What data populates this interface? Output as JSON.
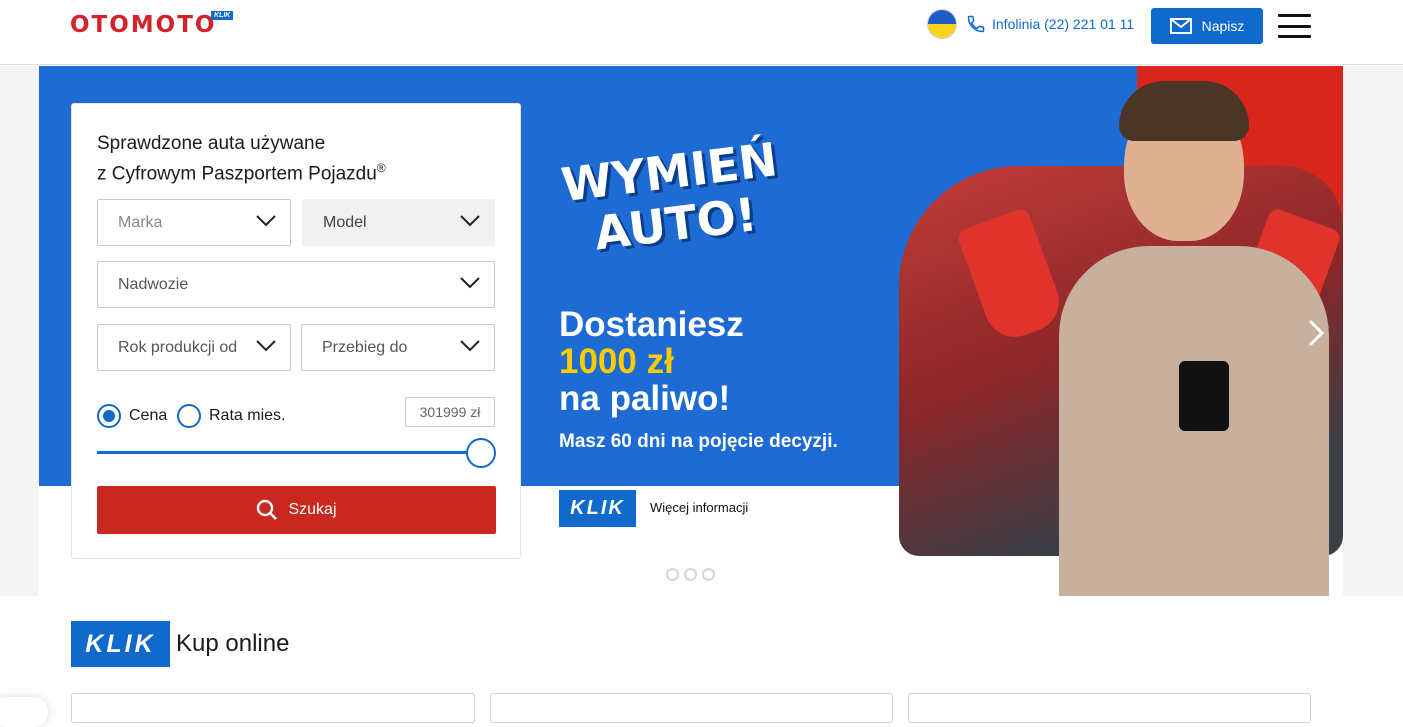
{
  "header": {
    "logo": "OTOMOTO",
    "logo_badge": "KLIK",
    "flag_icon": "ukraine-flag-icon",
    "infolinia": "Infolinia (22) 221 01 11",
    "napisz": "Napisz"
  },
  "search": {
    "title_line1": "Sprawdzone auta używane",
    "title_line2": "z Cyfrowym Paszportem Pojazdu",
    "title_mark": "®",
    "marka": "Marka",
    "model": "Model",
    "nadwozie": "Nadwozie",
    "rok": "Rok produkcji od",
    "przebieg": "Przebieg do",
    "radio_cena": "Cena",
    "radio_rata": "Rata mies.",
    "price_value": "301999 zł",
    "slider_fraction": 1.0,
    "button": "Szukaj"
  },
  "banner": {
    "headline_line1": "WYMIEŃ",
    "headline_line2": "AUTO!",
    "line1": "Dostaniesz",
    "line2": "1000 zł",
    "line3": "na paliwo!",
    "subline": "Masz 60 dni na pojęcie decyzji.",
    "badge": "KLIK",
    "more": "Więcej informacji",
    "slide_count": 3
  },
  "section": {
    "badge": "KLIK",
    "title": "Kup online"
  },
  "colors": {
    "brand_red": "#d2232a",
    "accent_blue": "#0f6acc",
    "button_red": "#c8281d",
    "banner_blue": "#1d6bd3",
    "highlight_yellow": "#ffcc00"
  }
}
